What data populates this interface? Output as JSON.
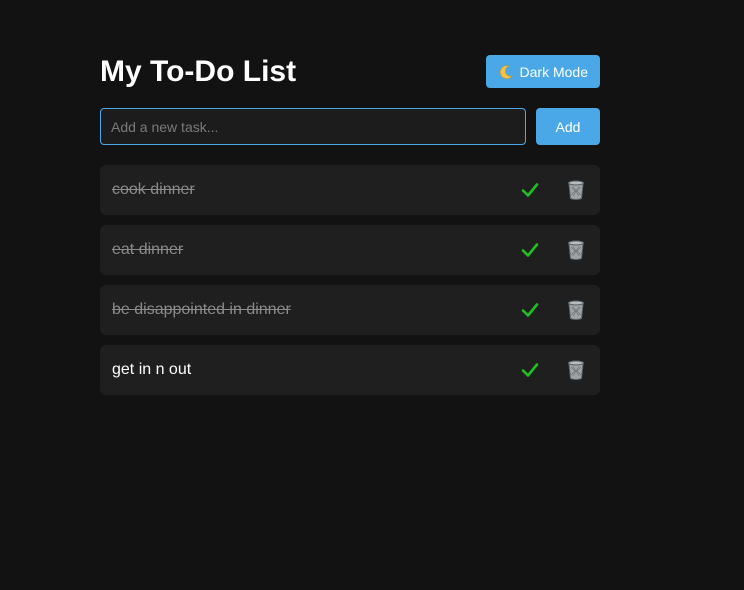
{
  "app": {
    "title": "My To-Do List",
    "mode_button": {
      "label": "Dark Mode",
      "icon": "moon-icon"
    }
  },
  "new_task": {
    "placeholder": "Add a new task...",
    "value": "",
    "add_label": "Add"
  },
  "tasks": [
    {
      "text": "cook dinner",
      "completed": true
    },
    {
      "text": "eat dinner",
      "completed": true
    },
    {
      "text": "be disappointed in dinner",
      "completed": true
    },
    {
      "text": "get in n out",
      "completed": false
    }
  ],
  "colors": {
    "background": "#121212",
    "accent": "#4aa8e8",
    "task_bg": "#1f1f1f",
    "check": "#22c022",
    "done_text": "#8a8a8a"
  }
}
